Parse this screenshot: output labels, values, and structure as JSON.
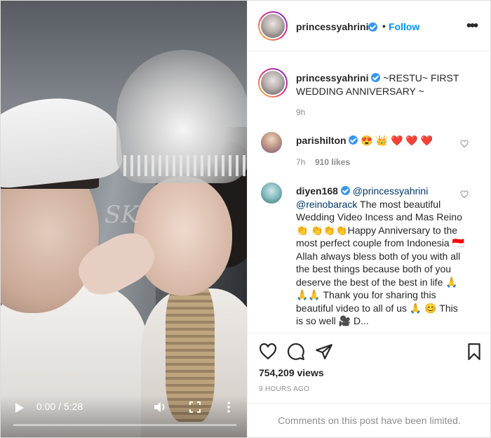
{
  "video": {
    "time": "0:00 / 5:28",
    "progress": 0,
    "watermark": "SK"
  },
  "header": {
    "username": "princessyahrini",
    "separator": "•",
    "follow_label": "Follow"
  },
  "caption": {
    "username": "princessyahrini",
    "text": "~RESTU~ FIRST WEDDING ANNIVERSARY ~",
    "time": "9h"
  },
  "comments": [
    {
      "username": "parishilton",
      "emojis": "😍 👑 ❤️ ❤️ ❤️",
      "time": "7h",
      "likes": "910 likes"
    },
    {
      "username": "diyen168",
      "mention1": "@princessyahrini",
      "mention2": "@reinobarack",
      "text": "The most beautiful Wedding Video Incess and Mas Reino👏 👏👏👏Happy Anniversary to the most perfect couple from Indonesia 🇮🇩 Allah always bless both of you with all the best things because both of you deserve the best of the best in life 🙏 🙏🙏 Thank you for sharing this beautiful video to all of us 🙏 😊 This is so well 🎥 D..."
    }
  ],
  "stats": {
    "views": "754,209 views",
    "posted": "9 HOURS AGO"
  },
  "footer": {
    "limited": "Comments on this post have been limited."
  },
  "icons": {
    "verified": "verified-badge-icon",
    "like": "heart-icon",
    "comment": "comment-bubble-icon",
    "share": "paper-plane-icon",
    "save": "bookmark-icon"
  },
  "colors": {
    "accent": "#0095f6",
    "verified": "#3897f0",
    "muted": "#8e8e8e"
  }
}
